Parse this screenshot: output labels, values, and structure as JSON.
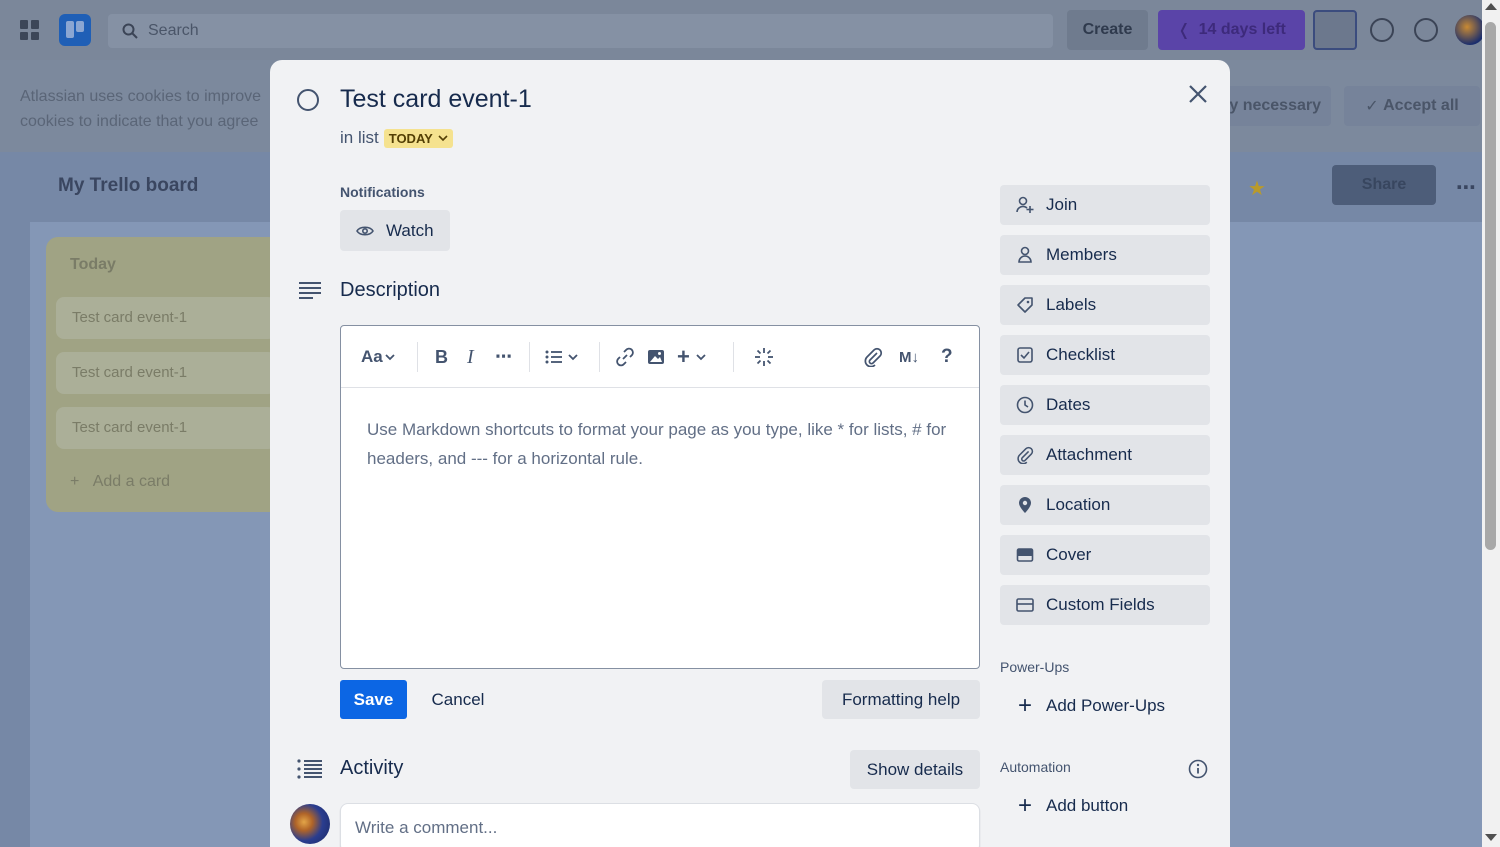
{
  "background": {
    "search_placeholder": "Search",
    "create_label": "Create",
    "trial_label": "14 days left",
    "cookie_line1": "Atlassian uses cookies to improve",
    "cookie_line2": "cookies to indicate that you agree",
    "cookie_necessary": "y necessary",
    "cookie_accept": "Accept all",
    "board_title": "My Trello board",
    "share_label": "Share",
    "list": {
      "title": "Today",
      "cards": [
        "Test card event-1",
        "Test card event-1",
        "Test card event-1"
      ],
      "add_card": "Add a card"
    }
  },
  "card": {
    "title": "Test card event-1",
    "in_list_prefix": "in list",
    "list_name": "TODAY",
    "notifications_label": "Notifications",
    "watch_label": "Watch",
    "description_title": "Description",
    "editor": {
      "text_style_label": "Aa",
      "placeholder": "Use Markdown shortcuts to format your page as you type, like * for lists, # for headers, and --- for a horizontal rule."
    },
    "save_label": "Save",
    "cancel_label": "Cancel",
    "formatting_help_label": "Formatting help",
    "activity_title": "Activity",
    "show_details_label": "Show details",
    "comment_placeholder": "Write a comment..."
  },
  "sidebar": {
    "actions": [
      {
        "label": "Join",
        "icon": "join-icon"
      },
      {
        "label": "Members",
        "icon": "members-icon"
      },
      {
        "label": "Labels",
        "icon": "labels-icon"
      },
      {
        "label": "Checklist",
        "icon": "checklist-icon"
      },
      {
        "label": "Dates",
        "icon": "clock-icon"
      },
      {
        "label": "Attachment",
        "icon": "paperclip-icon"
      },
      {
        "label": "Location",
        "icon": "location-pin-icon"
      },
      {
        "label": "Cover",
        "icon": "cover-icon"
      },
      {
        "label": "Custom Fields",
        "icon": "custom-fields-icon"
      }
    ],
    "powerups_label": "Power-Ups",
    "add_powerups_label": "Add Power-Ups",
    "automation_label": "Automation",
    "add_button_label": "Add button"
  },
  "colors": {
    "primary": "#0c66e4",
    "list_badge": "#f5e28f",
    "modal_bg": "#f1f2f4"
  }
}
